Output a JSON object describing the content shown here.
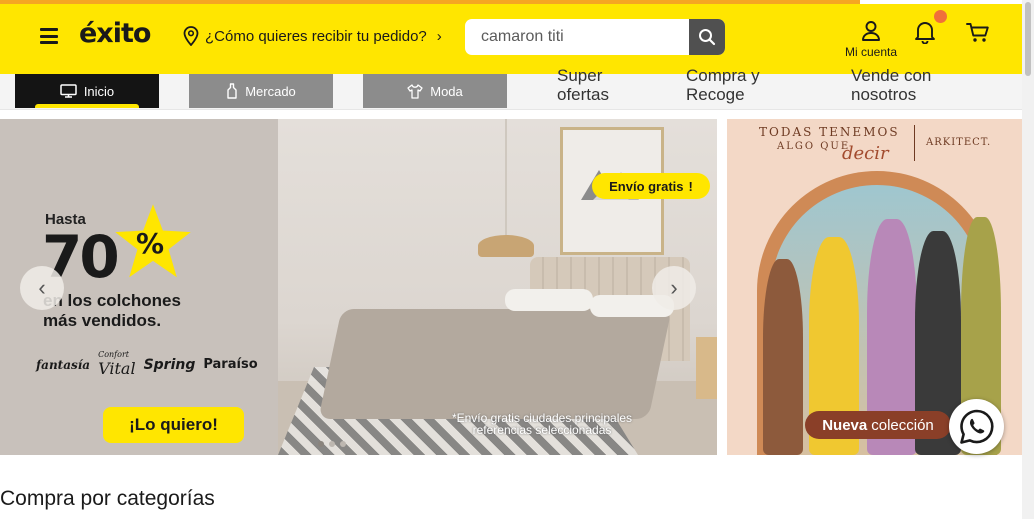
{
  "header": {
    "logo_text": "éxito",
    "location_prompt": "¿Cómo quieres recibir tu pedido?",
    "search": {
      "value": "camaron titi",
      "placeholder": ""
    },
    "account_label": "Mi cuenta",
    "brand_color": "#ffe600",
    "icons": [
      "menu-icon",
      "map-pin-icon",
      "chevron-right-icon",
      "search-icon",
      "user-icon",
      "bell-icon",
      "cart-icon"
    ]
  },
  "nav": {
    "tabs": [
      {
        "label": "Inicio",
        "icon": "monitor-icon",
        "active": true
      },
      {
        "label": "Mercado",
        "icon": "bottle-icon",
        "active": false
      },
      {
        "label": "Moda",
        "icon": "shirt-icon",
        "active": false
      }
    ],
    "links": [
      "Super ofertas",
      "Compra y Recoge",
      "Vende con nosotros"
    ],
    "link_lines": [
      [
        "Super",
        "ofertas"
      ],
      [
        "Compra y",
        "Recoge"
      ],
      [
        "Vende con",
        "nosotros"
      ]
    ]
  },
  "hero": {
    "prefix": "Hasta",
    "discount": "70",
    "percent": "%",
    "subtitle_lines": [
      "en los colchones",
      "más vendidos."
    ],
    "brands": [
      "fantasía",
      "Vital",
      "Spring",
      "Paraíso"
    ],
    "brand_vital_prefix": "Confort",
    "cta": "¡Lo quiero!",
    "shipping_badge": "Envío gratis",
    "shipping_mark": "!",
    "disclaimer_lines": [
      "*Envío gratis ciudades principales",
      "referencias seleccionadas"
    ],
    "slides_total": 3,
    "slide_active": 1
  },
  "promo": {
    "headline_top": "TODAS TENEMOS",
    "headline_mid": "ALGO QUE",
    "headline_script": "decir",
    "brand": "ARKITECT.",
    "badge_bold": "Nueva",
    "badge_rest": "colección"
  },
  "section": {
    "title": "Compra por categorías"
  },
  "floating": {
    "icon": "whatsapp-icon"
  }
}
